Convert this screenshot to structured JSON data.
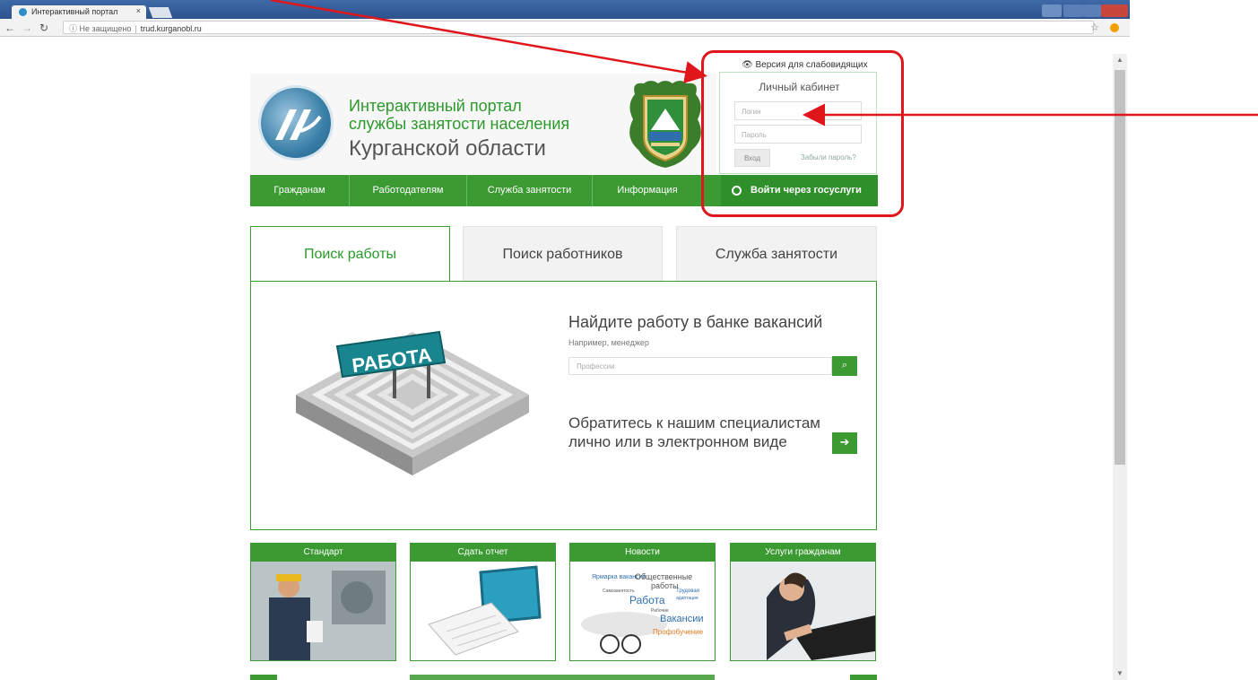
{
  "browser": {
    "tab_title": "Интерактивный портал",
    "tab_close": "×",
    "security": "Не защищено",
    "url": "trud.kurganobl.ru"
  },
  "header": {
    "title_line1": "Интерактивный портал",
    "title_line2": "службы занятости населения",
    "title_line3": "Курганской области",
    "low_vision": "Версия для слабовидящих"
  },
  "cabinet": {
    "title": "Личный кабинет",
    "login_placeholder": "Логин",
    "password_placeholder": "Пароль",
    "login_button": "Вход",
    "forgot": "Забыли пароль?"
  },
  "nav": {
    "items": [
      "Гражданам",
      "Работодателям",
      "Служба занятости",
      "Информация"
    ],
    "gosuslugi": "Войти через госуслуги"
  },
  "tabs": [
    "Поиск работы",
    "Поиск работников",
    "Служба занятости"
  ],
  "search": {
    "maze_label": "РАБОТА",
    "heading": "Найдите работу в банке вакансий",
    "example": "Например, менеджер",
    "placeholder": "Профессии",
    "contact_line1": "Обратитесь к нашим специалистам",
    "contact_line2": "лично или в электронном виде"
  },
  "cards": [
    "Стандарт",
    "Сдать отчет",
    "Новости",
    "Услуги гражданам"
  ],
  "news_cloud": [
    "Ярмарка вакансий",
    "Общественные",
    "работы",
    "Самозанятость",
    "Трудовая",
    "Работа",
    "адаптация",
    "Рабочие",
    "Вакансии",
    "Профобучение"
  ],
  "colors": {
    "brand_green": "#3c9a33",
    "annotation_red": "#e0161c",
    "title_green": "#2b9a2b"
  }
}
